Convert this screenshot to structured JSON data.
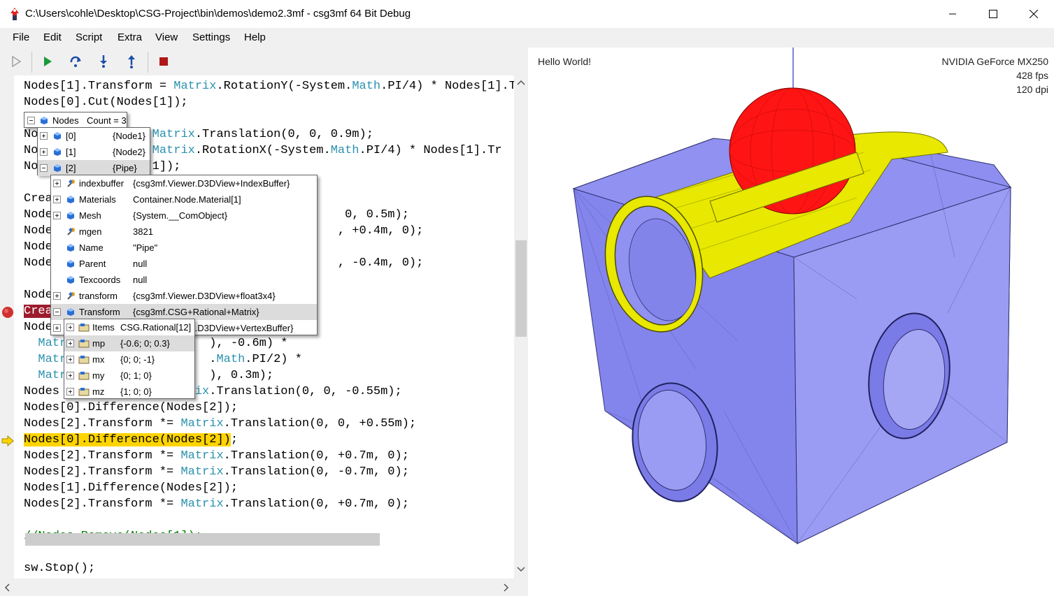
{
  "window": {
    "title": "C:\\Users\\cohle\\Desktop\\CSG-Project\\bin\\demos\\demo2.3mf - csg3mf 64 Bit Debug"
  },
  "menu": [
    "File",
    "Edit",
    "Script",
    "Extra",
    "View",
    "Settings",
    "Help"
  ],
  "toolbar": {
    "buttons": [
      "play-disabled-icon",
      "run-icon",
      "step-over-icon",
      "step-into-icon",
      "step-out-icon",
      "stop-icon"
    ]
  },
  "code_lines": [
    {
      "segments": [
        [
          "",
          "Nodes[1].Transform = "
        ],
        [
          "kw",
          "Matrix"
        ],
        [
          "",
          ".RotationY(-System."
        ],
        [
          "kw",
          "Math"
        ],
        [
          "",
          ".PI/4) * Nodes[1].Tr"
        ]
      ]
    },
    {
      "segments": [
        [
          "",
          "Nodes[0].Cut(Nodes[1]);"
        ]
      ]
    },
    {
      "segments": [
        [
          "",
          ""
        ]
      ]
    },
    {
      "segments": [
        [
          "",
          "No              = "
        ],
        [
          "kw",
          "Matrix"
        ],
        [
          "",
          ".Translation(0, 0, 0.9m);"
        ]
      ]
    },
    {
      "segments": [
        [
          "",
          "No              = "
        ],
        [
          "kw",
          "Matrix"
        ],
        [
          "",
          ".RotationX(-System."
        ],
        [
          "kw",
          "Math"
        ],
        [
          "",
          ".PI/4) * Nodes[1].Tr"
        ]
      ]
    },
    {
      "segments": [
        [
          "",
          "No               [1]);"
        ]
      ]
    },
    {
      "segments": [
        [
          "",
          ""
        ]
      ]
    },
    {
      "segments": [
        [
          "",
          "Crea"
        ]
      ]
    },
    {
      "segments": [
        [
          "",
          "Node                                         0, 0.5m);"
        ]
      ]
    },
    {
      "segments": [
        [
          "",
          "Node                                        , +0.4m, 0);"
        ]
      ]
    },
    {
      "segments": [
        [
          "",
          "Node"
        ]
      ]
    },
    {
      "segments": [
        [
          "",
          "Node                                        , -0.4m, 0);"
        ]
      ]
    },
    {
      "segments": [
        [
          "",
          ""
        ]
      ]
    },
    {
      "segments": [
        [
          "",
          "Node"
        ]
      ]
    },
    {
      "segments": [
        [
          "bpl",
          "Crea"
        ]
      ]
    },
    {
      "segments": [
        [
          "",
          "Node"
        ]
      ]
    },
    {
      "segments": [
        [
          "",
          "  "
        ],
        [
          "kw",
          "Matr"
        ],
        [
          "",
          "                    ), -0.6m) *"
        ]
      ]
    },
    {
      "segments": [
        [
          "",
          "  "
        ],
        [
          "kw",
          "Matr"
        ],
        [
          "",
          "                    ."
        ],
        [
          "kw",
          "Math"
        ],
        [
          "",
          ".PI/2) *"
        ]
      ]
    },
    {
      "segments": [
        [
          "",
          "  "
        ],
        [
          "kw",
          "Matr"
        ],
        [
          "",
          "                    ), 0.3m);"
        ]
      ]
    },
    {
      "segments": [
        [
          "",
          "Nodes                 "
        ],
        [
          "kw",
          "trix"
        ],
        [
          "",
          ".Translation(0, 0, -0.55m);"
        ]
      ]
    },
    {
      "segments": [
        [
          "",
          "Nodes[0].Difference(Nodes[2]);"
        ]
      ]
    },
    {
      "segments": [
        [
          "",
          "Nodes[2].Transform *= "
        ],
        [
          "kw",
          "Matrix"
        ],
        [
          "",
          ".Translation(0, 0, +0.55m);"
        ]
      ]
    },
    {
      "segments": [
        [
          "hl",
          "Nodes[0].Difference(Nodes[2])"
        ],
        [
          "",
          ";"
        ]
      ]
    },
    {
      "segments": [
        [
          "",
          "Nodes[2].Transform *= "
        ],
        [
          "kw",
          "Matrix"
        ],
        [
          "",
          ".Translation(0, +0.7m, 0);"
        ]
      ]
    },
    {
      "segments": [
        [
          "",
          "Nodes[2].Transform *= "
        ],
        [
          "kw",
          "Matrix"
        ],
        [
          "",
          ".Translation(0, -0.7m, 0);"
        ]
      ]
    },
    {
      "segments": [
        [
          "",
          "Nodes[1].Difference(Nodes[2]);"
        ]
      ]
    },
    {
      "segments": [
        [
          "",
          "Nodes[2].Transform *= "
        ],
        [
          "kw",
          "Matrix"
        ],
        [
          "",
          ".Translation(0, +0.7m, 0);"
        ]
      ]
    },
    {
      "segments": [
        [
          "",
          ""
        ]
      ]
    },
    {
      "segments": [
        [
          "cm",
          "//Nodes.Remove(Nodes[1]);"
        ]
      ]
    },
    {
      "segments": [
        [
          "",
          ""
        ]
      ]
    },
    {
      "segments": [
        [
          "",
          "sw.Stop();"
        ]
      ]
    }
  ],
  "debug": {
    "nodes_header": {
      "name": "Nodes",
      "value": "Count = 3"
    },
    "nodes_items": [
      {
        "name": "[0]",
        "value": "{Node1}"
      },
      {
        "name": "[1]",
        "value": "{Node2}"
      },
      {
        "name": "[2]",
        "value": "{Pipe}"
      }
    ],
    "pipe_members": [
      {
        "name": "indexbuffer",
        "value": "{csg3mf.Viewer.D3DView+IndexBuffer}",
        "expand": true,
        "icon": "wrench"
      },
      {
        "name": "Materials",
        "value": "Container.Node.Material[1]",
        "expand": true,
        "icon": "cube"
      },
      {
        "name": "Mesh",
        "value": "{System.__ComObject}",
        "expand": true,
        "icon": "cube"
      },
      {
        "name": "mgen",
        "value": "3821",
        "expand": false,
        "icon": "wrench"
      },
      {
        "name": "Name",
        "value": "\"Pipe\"",
        "expand": false,
        "icon": "cube"
      },
      {
        "name": "Parent",
        "value": "null",
        "expand": false,
        "icon": "cube"
      },
      {
        "name": "Texcoords",
        "value": "null",
        "expand": false,
        "icon": "cube"
      },
      {
        "name": "transform",
        "value": "{csg3mf.Viewer.D3DView+float3x4}",
        "expand": true,
        "icon": "wrench"
      },
      {
        "name": "Transform",
        "value": "{csg3mf.CSG+Rational+Matrix}",
        "expand": "minus",
        "icon": "cube"
      },
      {
        "name": "vertexbuffer",
        "value": "{csg3mf.Viewer.D3DView+VertexBuffer}",
        "expand": true,
        "icon": "wrench"
      }
    ],
    "matrix_members": [
      {
        "name": "Items",
        "value": "CSG.Rational[12]"
      },
      {
        "name": "mp",
        "value": "{-0.6; 0; 0.3}"
      },
      {
        "name": "mx",
        "value": "{0; 0; -1}"
      },
      {
        "name": "my",
        "value": "{0; 1; 0}"
      },
      {
        "name": "mz",
        "value": "{1; 0; 0}"
      }
    ]
  },
  "view": {
    "hello": "Hello World!",
    "gpu": "NVIDIA GeForce MX250",
    "fps": "428 fps",
    "dpi": "120 dpi",
    "colors": {
      "cube": "#8f90f0",
      "pipe": "#e8e800",
      "sphere": "#ff1010"
    }
  }
}
